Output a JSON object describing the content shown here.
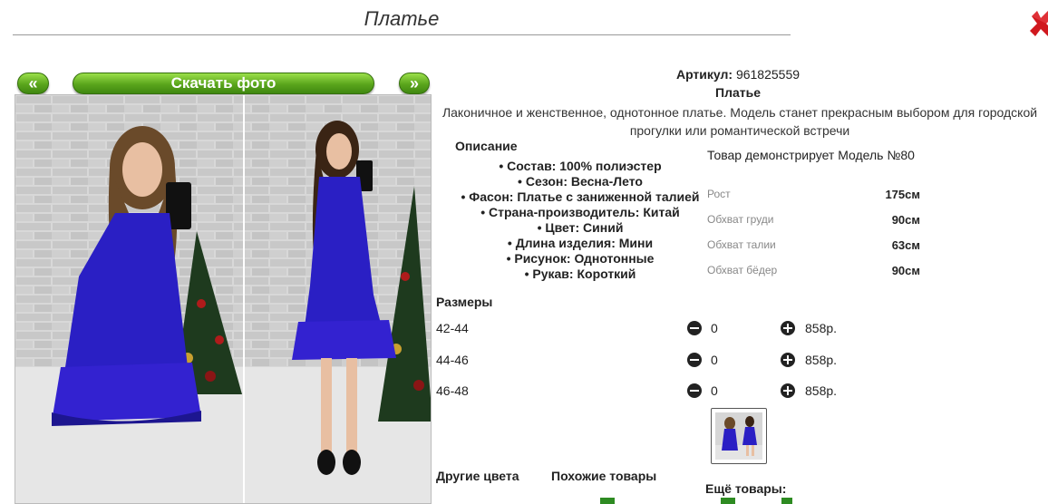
{
  "page": {
    "title": "Платье"
  },
  "nav": {
    "prev_label": "«",
    "download_label": "Скачать фото",
    "next_label": "»"
  },
  "product": {
    "article_label": "Артикул:",
    "article_value": "961825559",
    "name": "Платье",
    "description": "Лаконичное и женственное, однотонное платье. Модель станет прекрасным выбором для городской прогулки или романтической встречи"
  },
  "details": {
    "heading": "Описание",
    "items": [
      "Состав: 100% полиэстер",
      "Сезон: Весна-Лето",
      "Фасон: Платье с заниженной талией",
      "Страна-производитель: Китай",
      "Цвет: Синий",
      "Длина изделия: Мини",
      "Рисунок: Однотонные",
      "Рукав: Короткий"
    ]
  },
  "model": {
    "note": "Товар демонстрирует Модель №80",
    "measurements": [
      {
        "label": "Рост",
        "value": "175см"
      },
      {
        "label": "Обхват груди",
        "value": "90см"
      },
      {
        "label": "Обхват талии",
        "value": "63см"
      },
      {
        "label": "Обхват бёдер",
        "value": "90см"
      }
    ]
  },
  "sizes": {
    "heading": "Размеры",
    "rows": [
      {
        "size": "42-44",
        "qty": "0",
        "price": "858р."
      },
      {
        "size": "44-46",
        "qty": "0",
        "price": "858р."
      },
      {
        "size": "46-48",
        "qty": "0",
        "price": "858р."
      }
    ]
  },
  "bottom": {
    "other_colors": "Другие цвета",
    "similar": "Похожие товары",
    "more": "Ещё товары:"
  },
  "colors": {
    "accent_green": "#5aa51c",
    "close_red": "#d0181e",
    "dress_blue": "#2a1fc4"
  },
  "icons": {
    "close": "close-x-icon",
    "minus": "minus-circle-icon",
    "plus": "plus-circle-icon"
  }
}
